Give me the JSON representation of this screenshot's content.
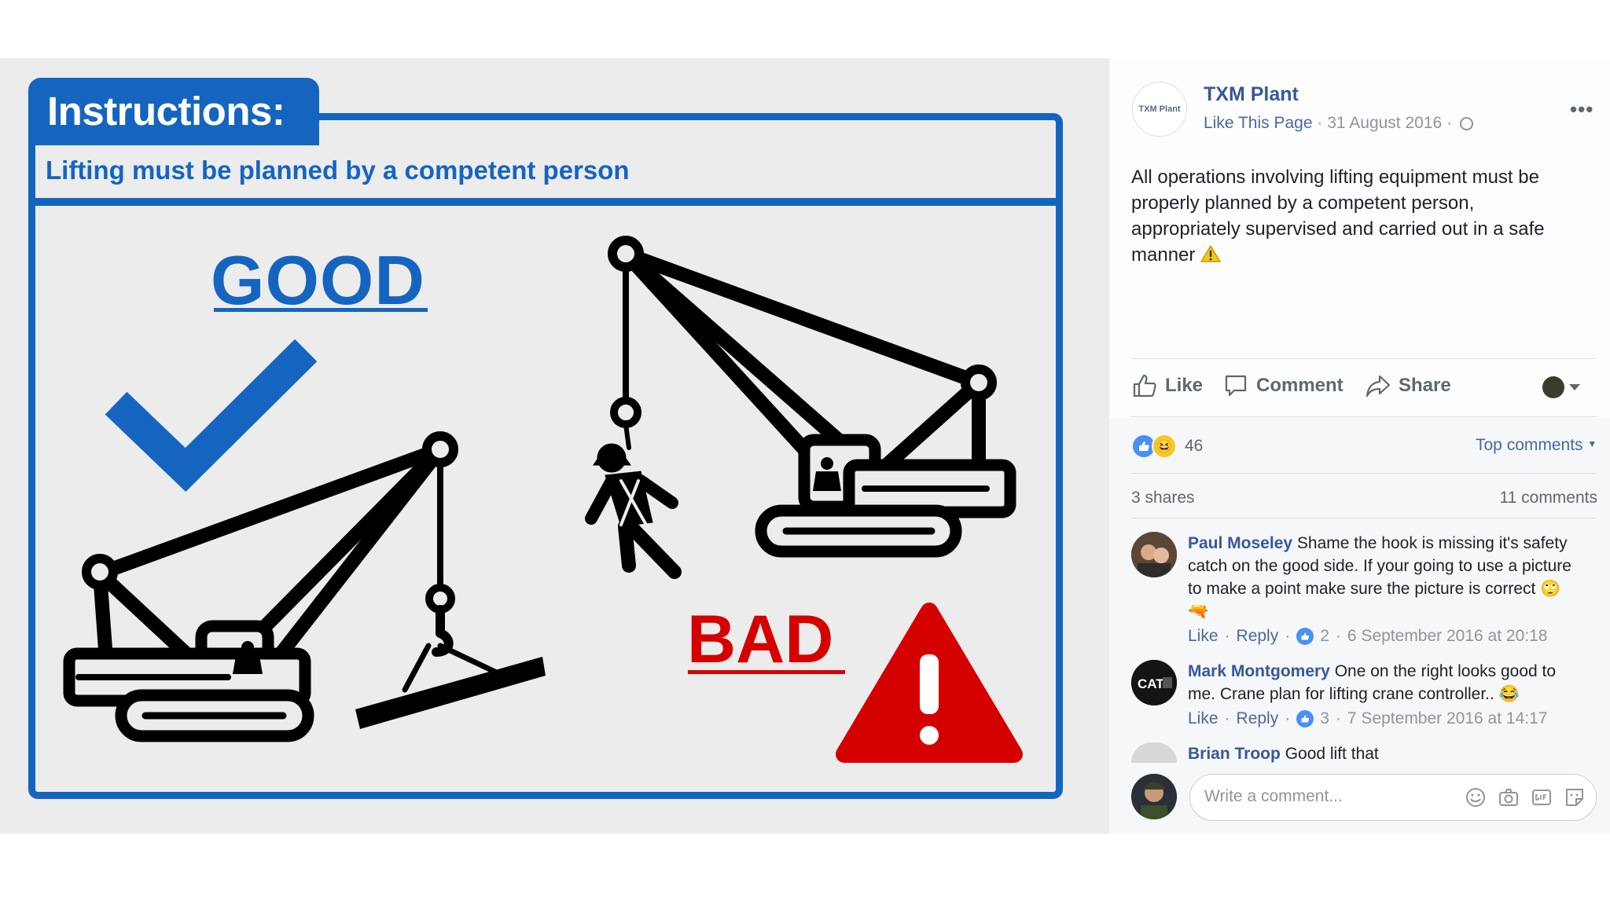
{
  "poster": {
    "title": "Instructions:",
    "subtitle": "Lifting must be planned by a competent person",
    "good_label": "GOOD",
    "bad_label": "BAD"
  },
  "post": {
    "page_logo_text": "TXM Plant",
    "page_name": "TXM Plant",
    "like_page": "Like This Page",
    "separator": "·",
    "date": "31 August 2016",
    "text": "All operations involving lifting equipment must be properly planned by a competent person, appropriately supervised and carried out in a safe manner"
  },
  "actions": {
    "like": "Like",
    "comment": "Comment",
    "share": "Share"
  },
  "stats": {
    "reactions_count": "46",
    "sort_label": "Top comments",
    "shares": "3 shares",
    "comments": "11 comments"
  },
  "comments": [
    {
      "author": "Paul Moseley",
      "text": "Shame the hook is missing it's safety catch on the good side. If your going to use a picture to make a point make sure the picture is correct",
      "emoji": "🙄🔫",
      "like": "Like",
      "reply": "Reply",
      "likes": "2",
      "time": "6 September 2016 at 20:18"
    },
    {
      "author": "Mark Montgomery",
      "text": "One on the right looks good to me. Crane plan for lifting crane controller..",
      "emoji": "😂",
      "like": "Like",
      "reply": "Reply",
      "likes": "3",
      "time": "7 September 2016 at 14:17"
    },
    {
      "author": "Brian Troop",
      "text": "Good lift that"
    }
  ],
  "composer": {
    "placeholder": "Write a comment..."
  },
  "colors": {
    "poster_blue": "#1565c0",
    "poster_red": "#d50000",
    "facebook_link": "#365899"
  }
}
